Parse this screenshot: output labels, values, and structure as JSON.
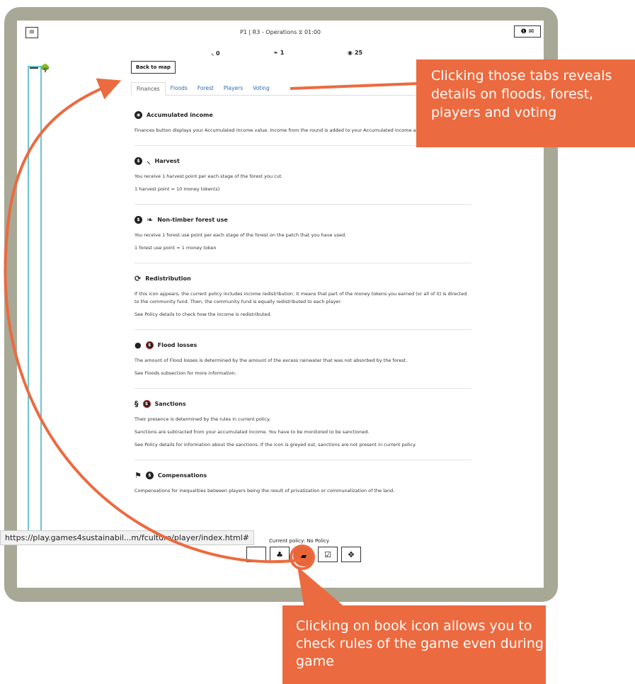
{
  "topbar": {
    "menu_icon": "hamburger-icon",
    "title": "P1 | R3 - Operations ⧖ 01:00",
    "right_icons": [
      "info-icon",
      "mail-icon"
    ]
  },
  "stats": [
    {
      "icon": "axe-icon",
      "glyph": "⸜",
      "value": "0"
    },
    {
      "icon": "berries-icon",
      "glyph": "❧",
      "value": "1"
    },
    {
      "icon": "money-icon",
      "glyph": "◉",
      "value": "25"
    }
  ],
  "back_button": "Back to map",
  "tabs": [
    "Finances",
    "Floods",
    "Forest",
    "Players",
    "Voting"
  ],
  "active_tab": "Finances",
  "sections": [
    {
      "title": "Accumulated income",
      "paragraphs": [
        "Finances button displays your Accumulated income value. Income from the round is added to your Accumulated income at the end of the phase."
      ]
    },
    {
      "title": "Harvest",
      "paragraphs": [
        "You receive 1 harvest point per each stage of the forest you cut.",
        "1 harvest point = 10 money token(s)"
      ]
    },
    {
      "title": "Non-timber forest use",
      "paragraphs": [
        "You receive 1 forest use point per each stage of the forest on the patch that you have used.",
        "1 forest use point = 1 money token"
      ]
    },
    {
      "title": "Redistribution",
      "paragraphs": [
        "If this icon appears, the current policy includes income redistribution. It means that part of the money tokens you earned (or all of it) is directed to the community fund. Then, the community fund is equally redistributed to each player.",
        "See Policy details to check how the income is redistributed."
      ]
    },
    {
      "title": "Flood losses",
      "paragraphs": [
        "The amount of Flood losses is determined by the amount of the excess rainwater that was not absorbed by the forest.",
        "See Floods subsection for more information."
      ]
    },
    {
      "title": "Sanctions",
      "paragraphs": [
        "Their presence is determined by the rules in current policy.",
        "Sanctions are subtracted from your accumulated income. You have to be monitored to be sanctioned.",
        "See Policy details for information about the sanctions. If the icon is greyed out, sanctions are not present in current policy."
      ]
    },
    {
      "title": "Compensations",
      "paragraphs": [
        "Compensations for inequalities between players being the result of privatization or communalization of the land."
      ]
    }
  ],
  "policy_label": "Current policy: No Policy",
  "toolbar_icons": [
    "blank-icon",
    "forest-icon",
    "book-icon",
    "checkbox-icon",
    "move-icon"
  ],
  "status_url": "https://play.games4sustainabil...m/fculture/player/index.html#",
  "callouts": {
    "tabs_note": "Clicking those tabs reveals details on floods, forest, players and voting",
    "book_note": "Clicking on book icon allows you to check rules of the game even during game"
  },
  "colors": {
    "accent": "#ec6a3f",
    "frame": "#a7a896",
    "link": "#2b6bb3",
    "strip": "#6cc4cf"
  }
}
